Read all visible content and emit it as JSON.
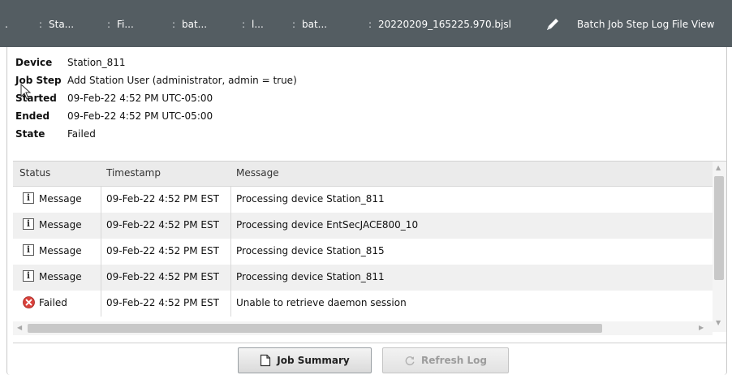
{
  "breadcrumb": {
    "leading": ".",
    "items": [
      "Sta...",
      "Fi...",
      "bat...",
      "l...",
      "bat...",
      "20220209_165225.970.bjsl"
    ],
    "separator": ":",
    "view_label": "Batch Job Step Log File View"
  },
  "details": {
    "device_label": "Device",
    "device_value": "Station_811",
    "jobstep_label": "Job Step",
    "jobstep_value": "Add Station User (administrator, admin = true)",
    "started_label": "Started",
    "started_value": "09-Feb-22 4:52 PM UTC-05:00",
    "ended_label": "Ended",
    "ended_value": "09-Feb-22 4:52 PM UTC-05:00",
    "state_label": "State",
    "state_value": "Failed"
  },
  "table": {
    "columns": [
      "Status",
      "Timestamp",
      "Message"
    ],
    "rows": [
      {
        "icon": "info-icon",
        "status": "Message",
        "timestamp": "09-Feb-22 4:52 PM EST",
        "message": "Processing device Station_811"
      },
      {
        "icon": "info-icon",
        "status": "Message",
        "timestamp": "09-Feb-22 4:52 PM EST",
        "message": "Processing device EntSecJACE800_10"
      },
      {
        "icon": "info-icon",
        "status": "Message",
        "timestamp": "09-Feb-22 4:52 PM EST",
        "message": "Processing device Station_815"
      },
      {
        "icon": "info-icon",
        "status": "Message",
        "timestamp": "09-Feb-22 4:52 PM EST",
        "message": "Processing device Station_811"
      },
      {
        "icon": "failed-icon",
        "status": "Failed",
        "timestamp": "09-Feb-22 4:52 PM EST",
        "message": "Unable to retrieve daemon session"
      }
    ],
    "info_glyph": "i"
  },
  "buttons": {
    "job_summary": "Job Summary",
    "refresh_log": "Refresh Log"
  },
  "colors": {
    "topbar": "#545d62",
    "row_alt": "#f0f0f0",
    "failed_red": "#d9413b"
  }
}
